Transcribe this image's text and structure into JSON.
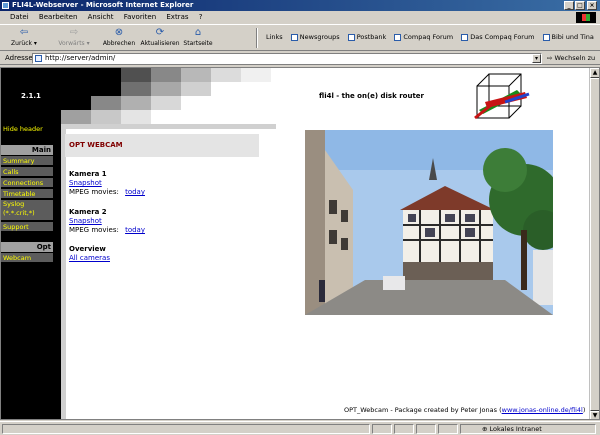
{
  "window": {
    "title": "FLI4L-Webserver - Microsoft Internet Explorer"
  },
  "menu": [
    "Datei",
    "Bearbeiten",
    "Ansicht",
    "Favoriten",
    "Extras",
    "?"
  ],
  "toolbar": {
    "back": "Zurück",
    "forward": "Vorwärts",
    "stop": "Abbrechen",
    "refresh": "Aktualisieren",
    "home": "Startseite"
  },
  "links": {
    "label": "Links",
    "items": [
      "Newsgroups",
      "Postbank",
      "Compaq Forum",
      "Das Compaq Forum",
      "Bibi und Tina"
    ]
  },
  "address": {
    "label": "Adresse",
    "url": "http://server/admin/",
    "go": "Wechseln zu"
  },
  "header": {
    "version": "2.1.1",
    "title": "fli4l - the on(e) disk router"
  },
  "sidebar": {
    "hide_header": "Hide header",
    "main_heading": "Main",
    "main_items": [
      "Summary",
      "Calls",
      "Connections",
      "Timetable",
      "Syslog (*.*.crit,*)",
      "Support"
    ],
    "opt_heading": "Opt",
    "opt_items": [
      "Webcam"
    ]
  },
  "content": {
    "section_title": "OPT WEBCAM",
    "camera1_heading": "Kamera 1",
    "camera1_snapshot": "Snapshot",
    "camera1_mpeg_label": "MPEG movies:",
    "camera1_mpeg_link": "today",
    "camera2_heading": "Kamera 2",
    "camera2_snapshot": "Snapshot",
    "camera2_mpeg_label": "MPEG movies:",
    "camera2_mpeg_link": "today",
    "overview_heading": "Overview",
    "overview_link": "All cameras"
  },
  "footer": {
    "text": "OPT_Webcam - Package created by Peter Jonas (",
    "link": "www.jonas-online.de/fli4l",
    "close": ")"
  },
  "status": {
    "zone": "Lokales Intranet"
  },
  "colors": {
    "title_bar": "#0a246a",
    "sidebar_link": "#ffff00",
    "section_title": "#800000",
    "link": "#0000cc"
  }
}
